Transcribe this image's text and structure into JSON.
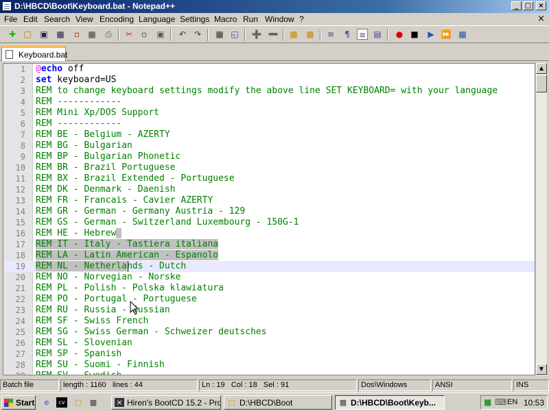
{
  "window": {
    "title": "D:\\HBCD\\Boot\\Keyboard.bat - Notepad++"
  },
  "menu": [
    "File",
    "Edit",
    "Search",
    "View",
    "Encoding",
    "Language",
    "Settings",
    "Macro",
    "Run",
    "Window",
    "?"
  ],
  "tab": {
    "label": "Keyboard.bat"
  },
  "editor": {
    "current_line": 19,
    "lines": [
      "@echo off",
      "set keyboard=US",
      "REM to change keyboard settings modify the above line SET KEYBOARD= with your language",
      "REM ------------",
      "REM Mini Xp/DOS Support",
      "REM ------------",
      "REM BE - Belgium - AZERTY",
      "REM BG - Bulgarian",
      "REM BP - Bulgarian Phonetic",
      "REM BR - Brazil Portuguese",
      "REM BX - Brazil Extended - Portuguese",
      "REM DK - Denmark - Daenish",
      "REM FR - Francais - Cavier AZERTY",
      "REM GR - German - Germany Austria - 129",
      "REM GS - German - Switzerland Luxembourg - 150G-1",
      "REM HE - Hebrew",
      "REM IT - Italy - Tastiera italiana",
      "REM LA - Latin American - Espanolo",
      "REM NL - Netherlands - Dutch",
      "REM NO - Norvegian - Norske",
      "REM PL - Polish - Polska klawiatura",
      "REM PO - Portugal - Portuguese",
      "REM RU - Russia - Russian",
      "REM SF - Swiss French",
      "REM SG - Swiss German - Schweizer deutsches",
      "REM SL - Slovenian",
      "REM SP - Spanish",
      "REM SU - Suomi - Finnish",
      "REM SV - Swedish"
    ]
  },
  "status": {
    "file_type": "Batch file",
    "length": "length : 1160",
    "lines": "lines : 44",
    "ln": "Ln : 19",
    "col": "Col : 18",
    "sel": "Sel : 91",
    "eol": "Dos\\Windows",
    "encoding": "ANSI",
    "mode": "INS"
  },
  "taskbar": {
    "start_label": "Start",
    "tasks": [
      {
        "label": "Hiren's BootCD 15.2 - Pro..."
      },
      {
        "label": "D:\\HBCD\\Boot"
      },
      {
        "label": "D:\\HBCD\\Boot\\Keyb..."
      }
    ],
    "lang": "EN",
    "time": "10:53"
  }
}
